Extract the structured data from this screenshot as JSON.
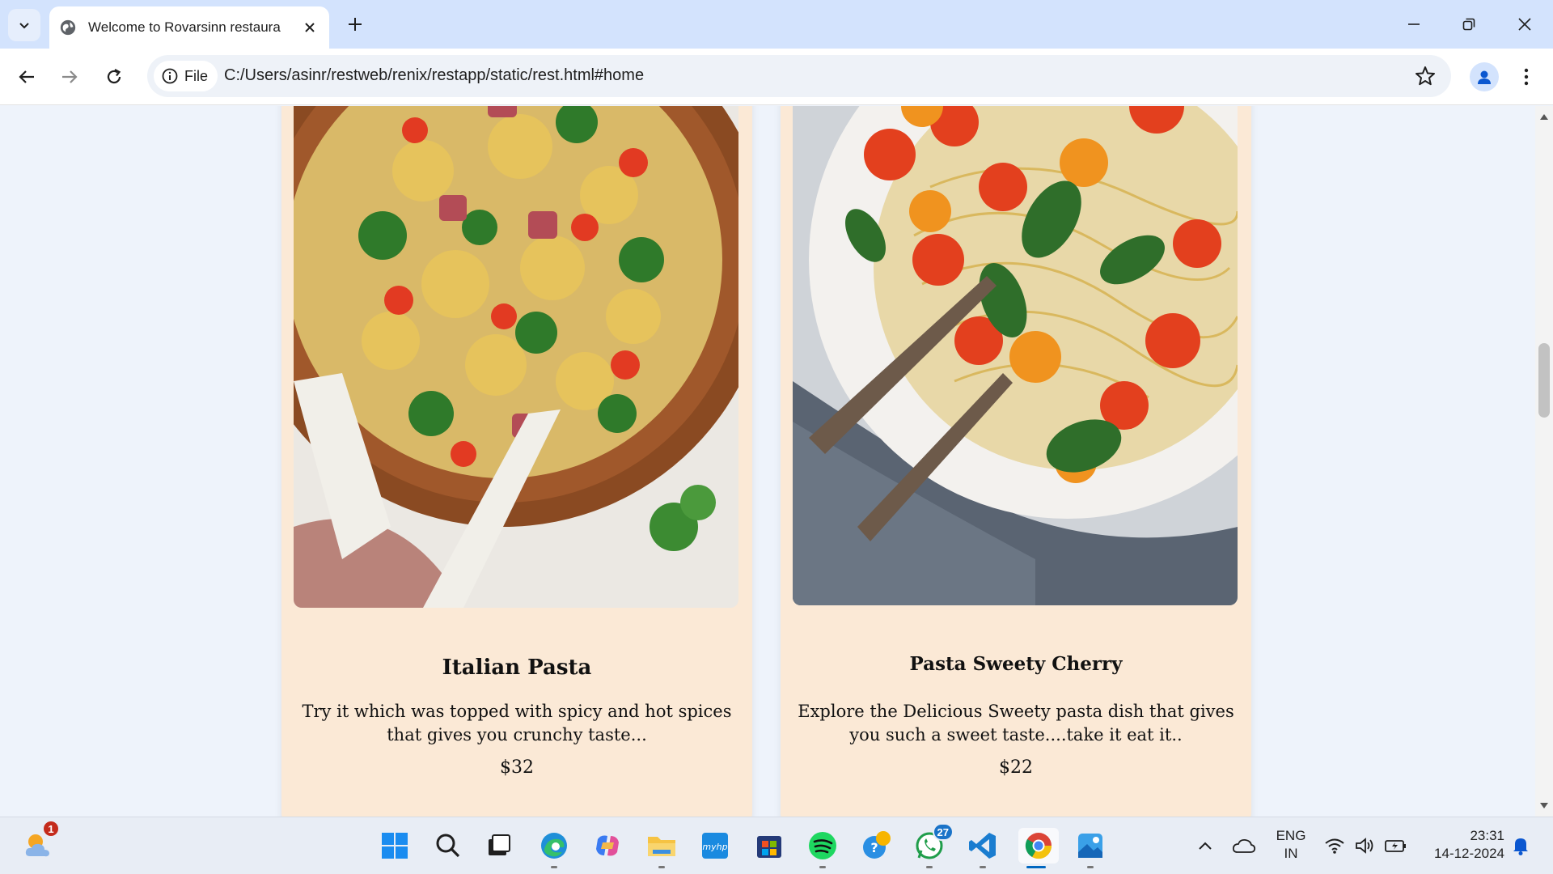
{
  "browser": {
    "tab_title": "Welcome to Rovarsinn restaura",
    "address_chip": "File",
    "url": "C:/Users/asinr/restweb/renix/restapp/static/rest.html#home"
  },
  "menu_items": [
    {
      "name": "Italian Pasta",
      "description": "Try it which was topped with spicy and hot spices that gives you crunchy taste...",
      "price": "$32"
    },
    {
      "name": "Pasta Sweety Cherry",
      "description": "Explore the Delicious Sweety pasta dish that gives you such a sweet taste....take it eat it..",
      "price": "$22"
    }
  ],
  "taskbar": {
    "weather_badge": "1",
    "whatsapp_badge": "27",
    "lang_line1": "ENG",
    "lang_line2": "IN",
    "time": "23:31",
    "date": "14-12-2024"
  },
  "colors": {
    "card_bg": "#fbe9d6",
    "page_bg": "#eef3fb",
    "tabbar_bg": "#d3e3fd"
  },
  "icons": [
    "tab-search-icon",
    "globe-icon",
    "close-icon",
    "plus-icon",
    "minimize-icon",
    "restore-icon",
    "window-close-icon",
    "back-icon",
    "forward-icon",
    "reload-icon",
    "info-icon",
    "star-icon",
    "profile-icon",
    "more-icon",
    "weather-icon",
    "windows-start-icon",
    "search-icon",
    "task-view-icon",
    "edge-icon",
    "copilot-icon",
    "file-explorer-icon",
    "myhp-icon",
    "store-icon",
    "spotify-icon",
    "feedback-icon",
    "whatsapp-icon",
    "vscode-icon",
    "chrome-icon",
    "photos-icon",
    "chevron-up-icon",
    "onedrive-icon",
    "wifi-icon",
    "volume-icon",
    "battery-icon",
    "bell-icon"
  ]
}
